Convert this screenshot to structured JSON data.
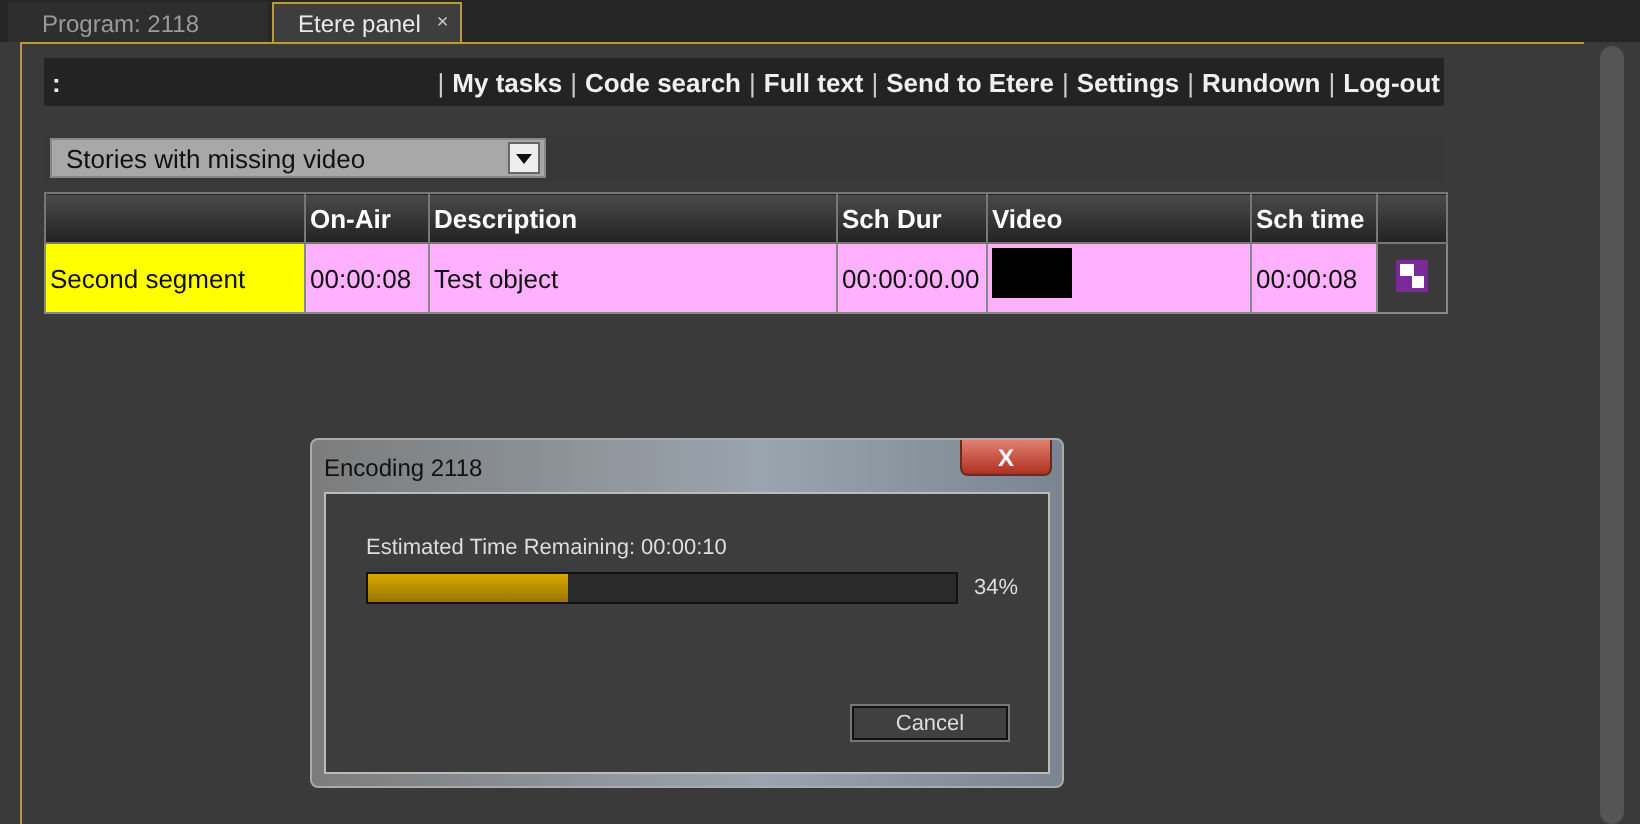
{
  "tabs": [
    {
      "label": "Program: 2118",
      "selected": false
    },
    {
      "label": "Etere panel",
      "selected": true,
      "close": "×"
    }
  ],
  "toolbar": {
    "prefix": ":",
    "separator": "|",
    "links": [
      "My tasks",
      "Code search",
      "Full text",
      "Send to Etere",
      "Settings",
      "Rundown",
      "Log-out"
    ]
  },
  "filter": {
    "value": "Stories with missing video"
  },
  "table": {
    "columns": [
      "",
      "On-Air",
      "Description",
      "Sch Dur",
      "Video",
      "Sch time",
      ""
    ],
    "rows": [
      {
        "name": {
          "text": "Second segment",
          "color": "#ffff00"
        },
        "color": "#ffb0ff",
        "on_air": "00:00:08",
        "description": "Test object",
        "sch_dur": "00:00:00.00",
        "sch_time": "00:00:08"
      }
    ]
  },
  "dialog": {
    "title": "Encoding 2118",
    "close": "X",
    "message": "Estimated Time Remaining: 00:00:10",
    "level": 0.34,
    "reading": "34%",
    "button": "Cancel"
  }
}
